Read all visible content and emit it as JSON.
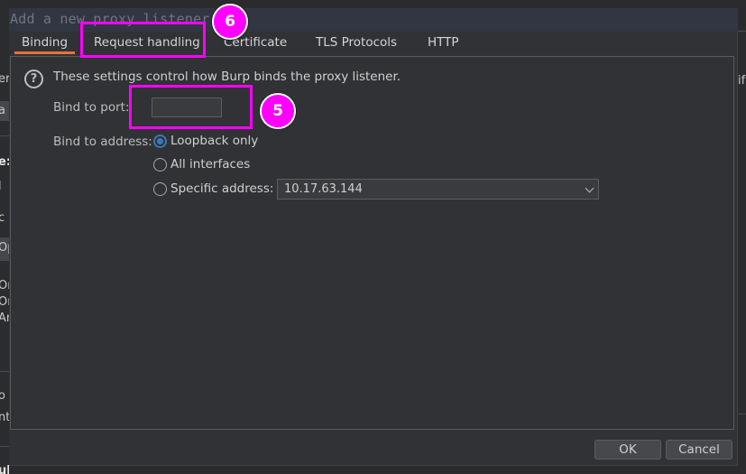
{
  "dialog": {
    "title": "Add a new proxy listener",
    "tabs": [
      {
        "label": "Binding",
        "active": true
      },
      {
        "label": "Request handling",
        "active": false
      },
      {
        "label": "Certificate",
        "active": false
      },
      {
        "label": "TLS Protocols",
        "active": false
      },
      {
        "label": "HTTP",
        "active": false
      }
    ],
    "info_text": "These settings control how Burp binds the proxy listener.",
    "info_icon": "help-circle-icon",
    "bind_port": {
      "label": "Bind to port:",
      "value": ""
    },
    "bind_address": {
      "label": "Bind to address:",
      "options": [
        {
          "label": "Loopback only",
          "checked": true
        },
        {
          "label": "All interfaces",
          "checked": false
        },
        {
          "label": "Specific address:",
          "checked": false
        }
      ],
      "specific_address_value": "10.17.63.144"
    },
    "buttons": {
      "ok": "OK",
      "cancel": "Cancel"
    }
  },
  "annotations": [
    {
      "number": "5",
      "target": "bind-to-port-input",
      "color": "#ff00ff"
    },
    {
      "number": "6",
      "target": "tab-request-handling",
      "color": "#ff00ff"
    }
  ],
  "background": {
    "left_fragments": [
      "er",
      "a",
      "e:",
      "l",
      "c",
      "Op",
      "Or",
      "Or",
      "Ar",
      "o",
      "nt",
      "ules"
    ],
    "right_fragments": [
      "if"
    ]
  },
  "colors": {
    "accent_tab": "#e8703a",
    "radio_selected": "#3a78b8",
    "annotation": "#ff00ff"
  }
}
